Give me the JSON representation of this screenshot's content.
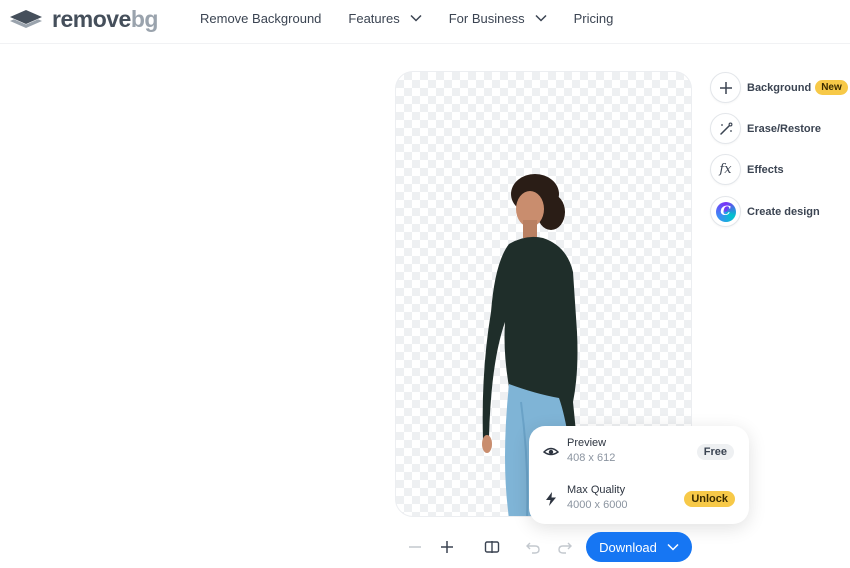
{
  "header": {
    "logo": {
      "word1": "remove",
      "word2": "bg"
    },
    "nav": [
      {
        "label": "Remove Background",
        "has_dropdown": false
      },
      {
        "label": "Features",
        "has_dropdown": true
      },
      {
        "label": "For Business",
        "has_dropdown": true
      },
      {
        "label": "Pricing",
        "has_dropdown": false
      }
    ]
  },
  "tools": [
    {
      "label": "Background",
      "icon": "plus-icon",
      "badge": "New"
    },
    {
      "label": "Erase/Restore",
      "icon": "magic-brush-icon"
    },
    {
      "label": "Effects",
      "icon": "fx-icon",
      "glyph": "fx"
    },
    {
      "label": "Create design",
      "icon": "canva-icon",
      "glyph": "C"
    }
  ],
  "download_menu": {
    "preview": {
      "title": "Preview",
      "size": "408 x 612",
      "pill": "Free",
      "icon": "eye-icon"
    },
    "max_quality": {
      "title": "Max Quality",
      "size": "4000 x 6000",
      "pill": "Unlock",
      "icon": "lightning-icon"
    }
  },
  "toolbar": {
    "download_label": "Download",
    "icons": [
      "zoom-out-icon",
      "zoom-in-icon",
      "compare-icon",
      "undo-icon",
      "redo-icon"
    ]
  },
  "colors": {
    "accent": "#1676f3",
    "badge_yellow": "#f7c948",
    "logo_dark": "#454f5b",
    "logo_light": "#9aa3ad"
  }
}
